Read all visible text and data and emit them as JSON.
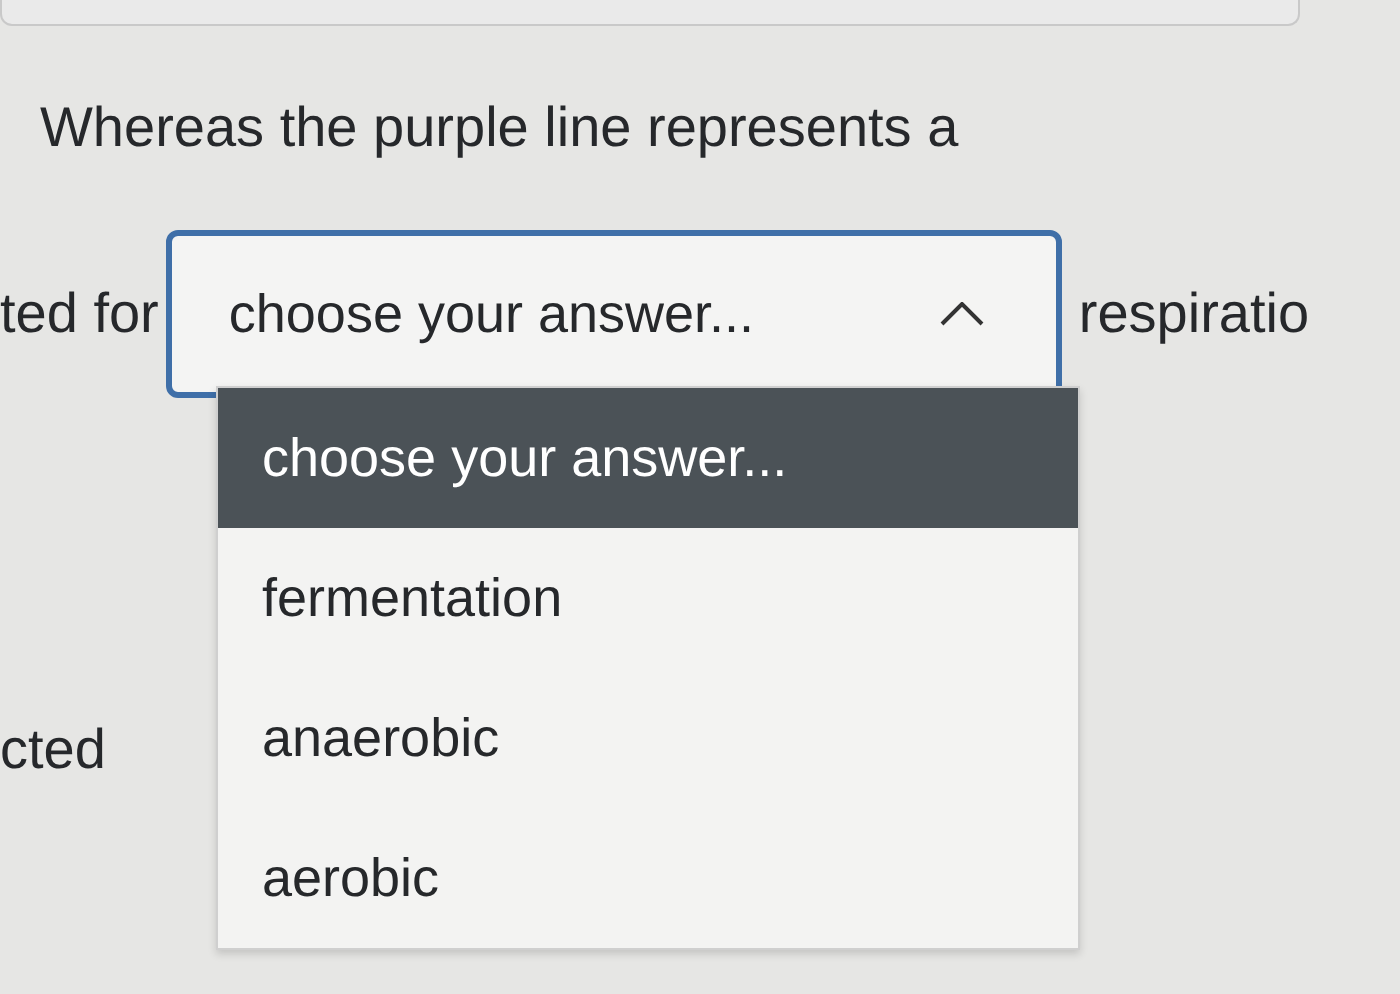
{
  "heading": "Whereas the purple line represents a",
  "fragment_before_select": "ted for",
  "select": {
    "value": "choose your answer...",
    "expanded": true
  },
  "fragment_after_select": "respiratio",
  "options": [
    {
      "label": "choose your answer...",
      "selected": true
    },
    {
      "label": "fermentation",
      "selected": false
    },
    {
      "label": "anaerobic",
      "selected": false
    },
    {
      "label": "aerobic",
      "selected": false
    }
  ],
  "fragment_below": "cted"
}
